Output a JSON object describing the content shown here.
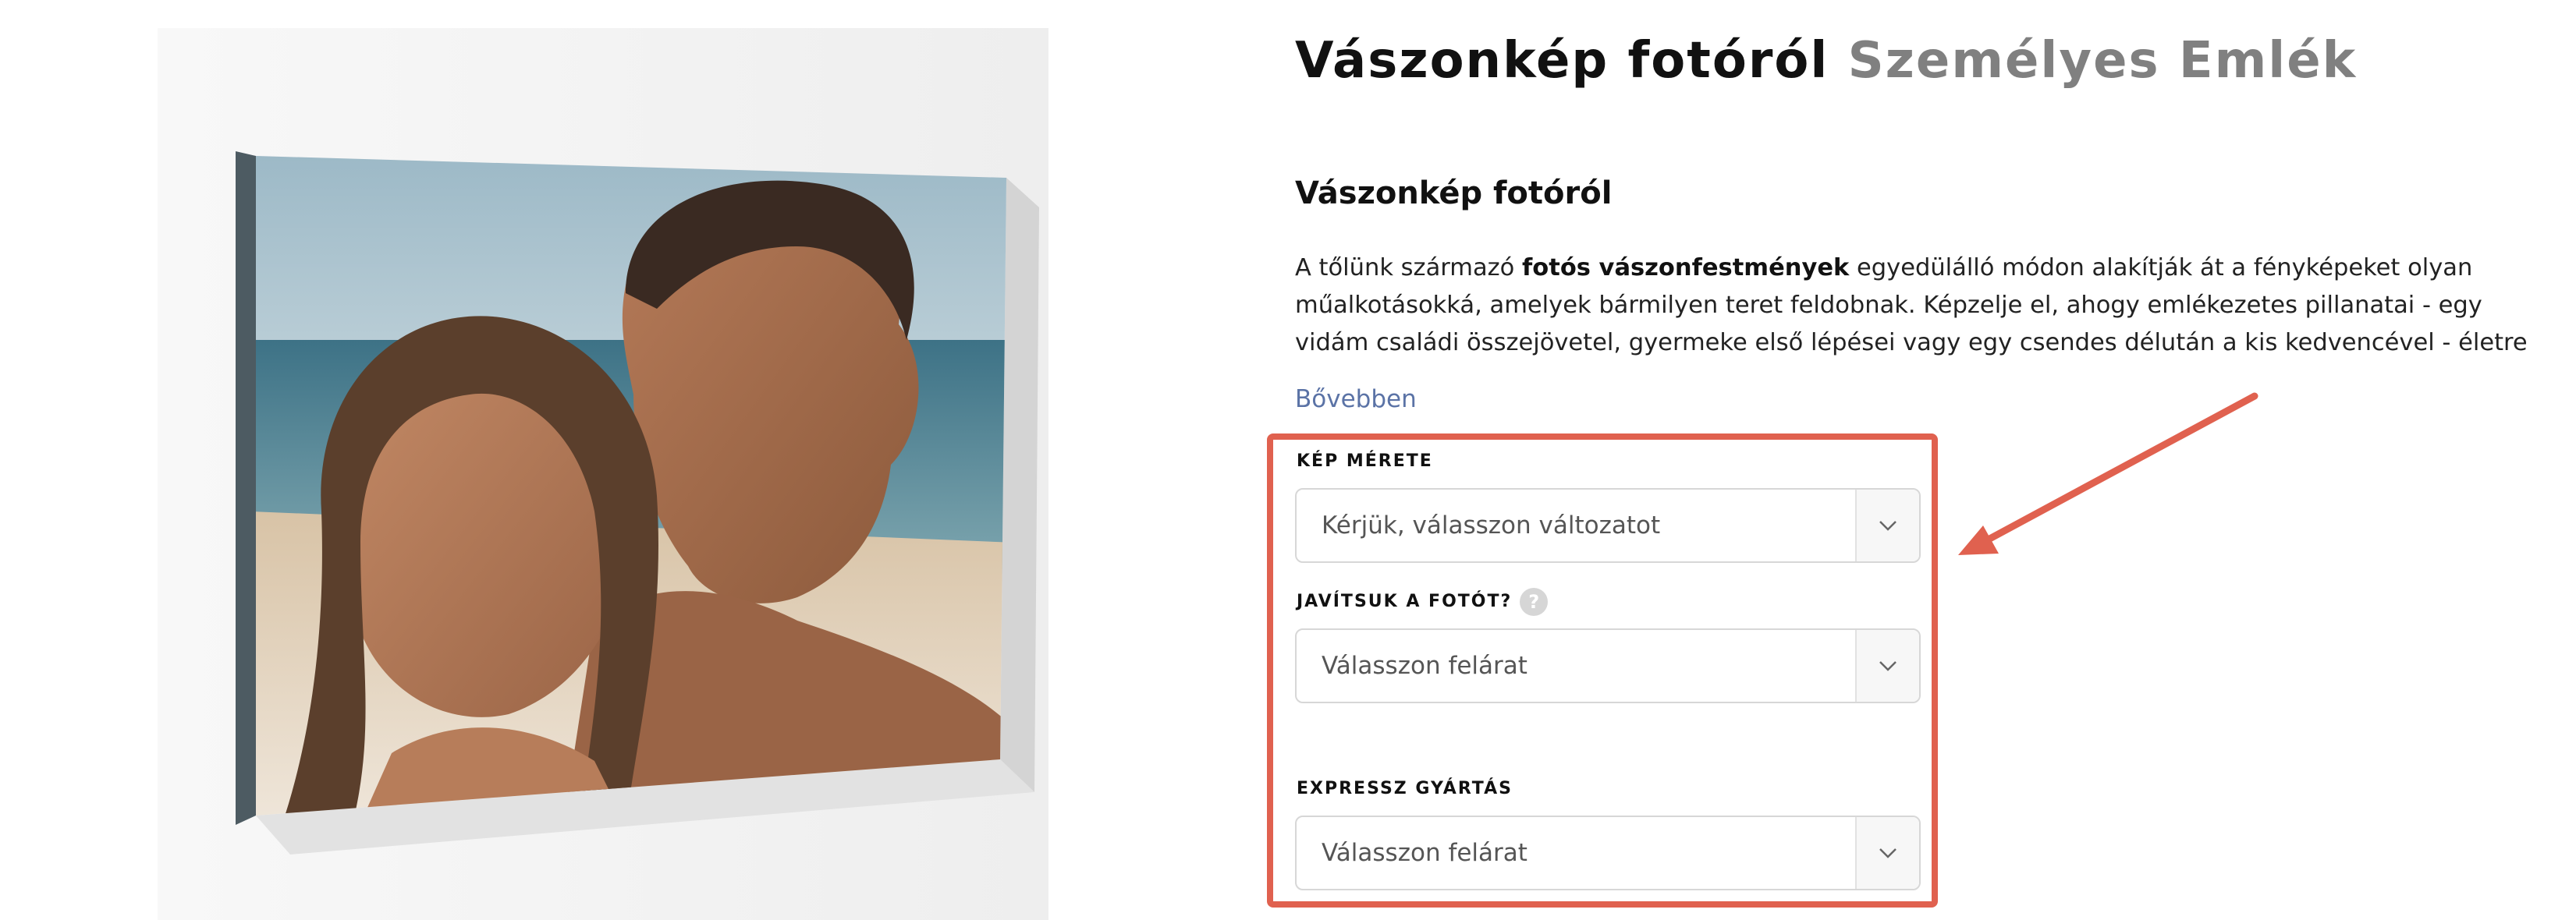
{
  "product": {
    "title": "Vászonkép fotóról",
    "subtitle": "Személyes Emlék",
    "section_heading": "Vászonkép fotóról",
    "description": {
      "intro": "A tőlünk származó ",
      "highlight": "fotós vászonfestmények",
      "rest": " egyedülálló módon alakítják át a fényképeket olyan műalkotásokká, amelyek bármilyen teret feldobnak. Képzelje el, ahogy emlékezetes pillanatai - egy vidám családi összejövetel, gyermeke első lépései vagy egy csendes délután a kis kedvencével - életre kelnek egy kiváló minőségű vásznon,"
    },
    "more_link": "Bővebben"
  },
  "options": {
    "size": {
      "label": "KÉP MÉRETE",
      "placeholder": "Kérjük, válasszon változatot"
    },
    "enhance": {
      "label": "JAVÍTSUK A FOTÓT?",
      "help_glyph": "?",
      "placeholder": "Válasszon felárat"
    },
    "express": {
      "label": "EXPRESSZ GYÁRTÁS",
      "placeholder": "Válasszon felárat"
    }
  },
  "icons": {
    "help": "question-mark-icon",
    "dropdown": "chevron-down-icon",
    "annotation": "arrow-icon"
  },
  "colors": {
    "highlight": "#e0614f",
    "link": "#5b73a6",
    "title_secondary": "#808080"
  }
}
